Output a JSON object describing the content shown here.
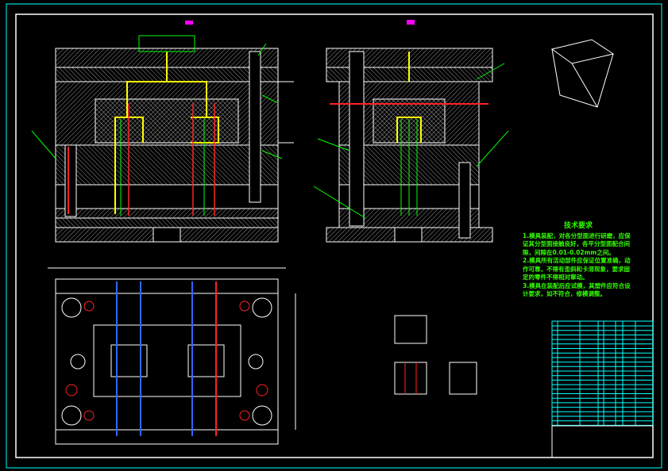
{
  "colors": {
    "background": "#000000",
    "frame": "#00ffff",
    "border": "#ffffff",
    "hatch": "#ffffff",
    "text": "#33ff00",
    "accent_yellow": "#ffff00",
    "accent_red": "#ff2020",
    "accent_magenta": "#ff00ff"
  },
  "tech_requirements": {
    "title": "技术要求",
    "items": [
      "1.模具装配，对各分型面进行研磨，应保证其分型面接触良好，各平分型面配合间隙，间隙在0.01-0.02mm之间。",
      "2.模具所有活动部件应保证位置准确，动作可靠，不得有歪斜和卡滞现象，要求固定的零件不得相对窜动。",
      "3.模具在装配后应试模，其塑件应符合设计要求，如不符合，修模调整。"
    ]
  },
  "views": [
    "front-section-left",
    "front-section-right",
    "top-plan-view",
    "isometric-part",
    "part-detail-views",
    "title-block"
  ]
}
